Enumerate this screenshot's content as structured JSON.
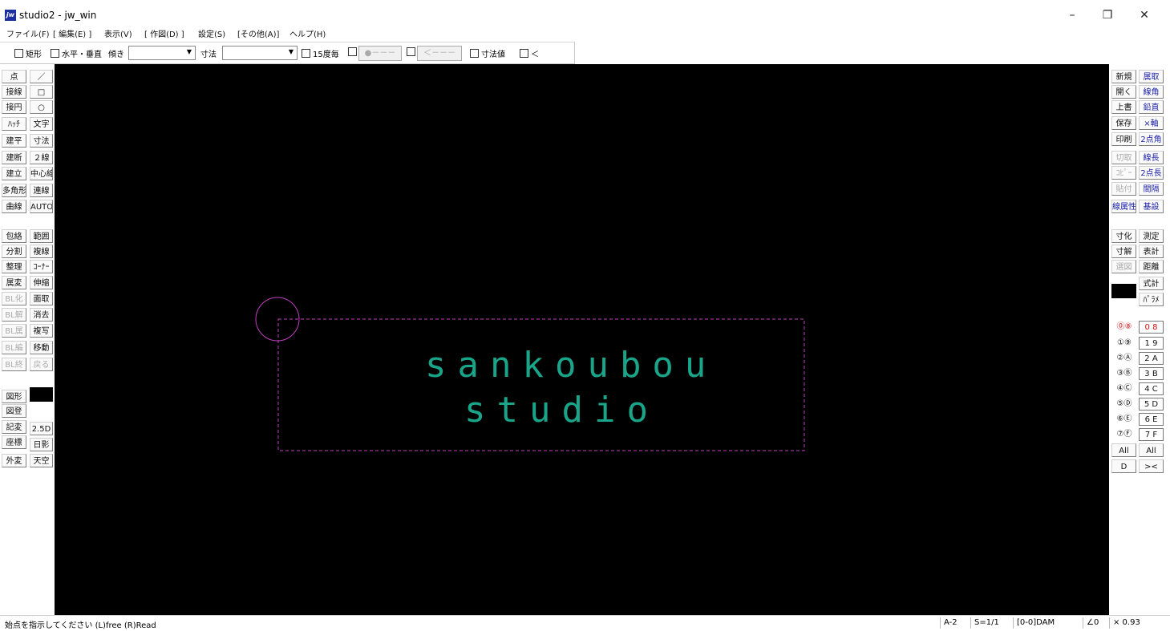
{
  "window": {
    "title": "studio2 - jw_win",
    "icon_label": "jw",
    "minimize": "–",
    "maximize": "❐",
    "close": "✕"
  },
  "menu": [
    "ファイル(F)",
    "[ 編集(E) ]",
    "表示(V)",
    "[ 作図(D) ]",
    "設定(S)",
    "[その他(A)]",
    "ヘルプ(H)"
  ],
  "toolbar": {
    "rect_label": "矩形",
    "hv_label": "水平・垂直",
    "tilt_label": "傾き",
    "dim_label": "寸法",
    "deg15_label": "15度毎",
    "dot_btn": "●－－－",
    "arrow_btn": "＜－－－",
    "dimval_label": "寸法値",
    "lt_label": "＜"
  },
  "left_tools": {
    "col1_a": [
      "点",
      "接線",
      "接円",
      "ﾊｯﾁ",
      "建平",
      "建断",
      "建立",
      "多角形",
      "曲線"
    ],
    "col2_a": [
      "／",
      "□",
      "○",
      "文字",
      "寸法",
      "２線",
      "中心線",
      "連線",
      "AUTO"
    ],
    "col1_b": [
      "包絡",
      "分割",
      "整理",
      "属変",
      "BL化",
      "BL解",
      "BL属",
      "BL編",
      "BL終"
    ],
    "col2_b": [
      "範囲",
      "複線",
      "ｺｰﾅｰ",
      "伸縮",
      "面取",
      "消去",
      "複写",
      "移動",
      "戻る"
    ],
    "col1_c": [
      "図形",
      "図登",
      "記変",
      "座標",
      "外変"
    ],
    "col2_c": [
      "2.5D",
      "日影",
      "天空"
    ]
  },
  "right_tools": {
    "col1_a": [
      "新規",
      "開く",
      "上書",
      "保存",
      "印刷",
      "切取",
      "ｺﾋﾟｰ",
      "貼付",
      "線属性"
    ],
    "col2_a": [
      "属取",
      "線角",
      "鉛直",
      "×軸",
      "2点角",
      "線長",
      "2点長",
      "間隔",
      "基設"
    ],
    "col1_b": [
      "寸化",
      "寸解",
      "選図"
    ],
    "col2_b": [
      "測定",
      "表計",
      "距離",
      "式計",
      "ﾊﾟﾗﾒ"
    ],
    "layer_groups": [
      "⓪⑧",
      "①⑨",
      "②Ⓐ",
      "③Ⓑ",
      "④Ⓒ",
      "⑤Ⓓ",
      "⑥Ⓔ",
      "⑦Ⓕ"
    ],
    "layers": [
      "0 8",
      "1 9",
      "2 A",
      "3 B",
      "4 C",
      "5 D",
      "6 E",
      "7 F"
    ],
    "all_left": "All",
    "all_right": "All",
    "d_btn": "D",
    "x_btn": "><"
  },
  "drawing": {
    "line1": "sankoubou",
    "line2": "studio",
    "text_color": "#19a58a",
    "frame_color": "#c040c0",
    "background": "#000000"
  },
  "status": {
    "message": "始点を指示してください (L)free (R)Read",
    "paper": "A-2",
    "scale": "S=1/1",
    "layer": "[0-0]DAM",
    "angle": "∠0",
    "zoom": "× 0.93"
  }
}
